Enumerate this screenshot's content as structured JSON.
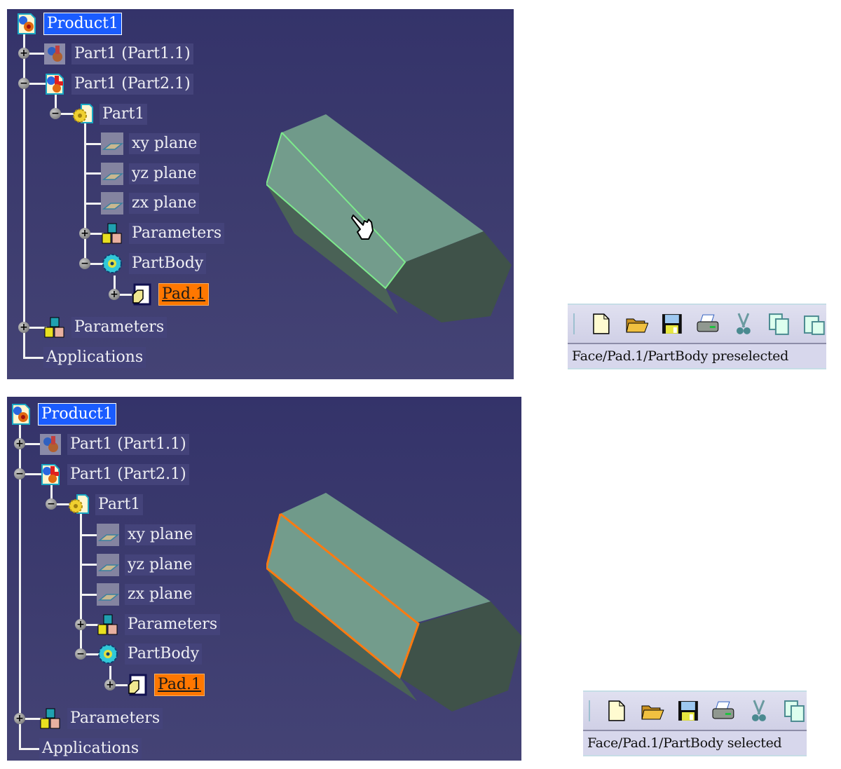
{
  "panels": [
    {
      "state": "preselected",
      "tree": {
        "root": "Product1",
        "items": [
          {
            "label": "Part1 (Part1.1)",
            "toggle": "+",
            "icon": "part-instance-icon"
          },
          {
            "label": "Part1 (Part2.1)",
            "toggle": "-",
            "icon": "part-instance-active-icon"
          },
          {
            "label": "Part1",
            "toggle": "-",
            "icon": "part-gear-icon"
          },
          {
            "label": "xy plane",
            "icon": "plane-icon"
          },
          {
            "label": "yz plane",
            "icon": "plane-icon"
          },
          {
            "label": "zx plane",
            "icon": "plane-icon"
          },
          {
            "label": "Parameters",
            "toggle": "+",
            "icon": "parameters-icon"
          },
          {
            "label": "PartBody",
            "toggle": "-",
            "icon": "partbody-icon"
          },
          {
            "label": "Pad.1",
            "toggle": "+",
            "icon": "pad-icon",
            "highlighted": true
          },
          {
            "label": "Parameters",
            "toggle": "+",
            "icon": "parameters-icon"
          },
          {
            "label": "Applications",
            "icon": null
          }
        ]
      },
      "edge_color": "#7dea8c",
      "cursor": "hand-pointer-icon",
      "toolbar": {
        "icons": [
          "new-file-icon",
          "open-folder-icon",
          "save-icon",
          "print-icon",
          "cut-icon",
          "copy-icon",
          "paste-icon"
        ],
        "status": "Face/Pad.1/PartBody preselected"
      }
    },
    {
      "state": "selected",
      "tree": {
        "root": "Product1",
        "items": [
          {
            "label": "Part1 (Part1.1)",
            "toggle": "+",
            "icon": "part-instance-icon"
          },
          {
            "label": "Part1 (Part2.1)",
            "toggle": "-",
            "icon": "part-instance-active-icon"
          },
          {
            "label": "Part1",
            "toggle": "-",
            "icon": "part-gear-icon"
          },
          {
            "label": "xy plane",
            "icon": "plane-icon"
          },
          {
            "label": "yz plane",
            "icon": "plane-icon"
          },
          {
            "label": "zx plane",
            "icon": "plane-icon"
          },
          {
            "label": "Parameters",
            "toggle": "+",
            "icon": "parameters-icon"
          },
          {
            "label": "PartBody",
            "toggle": "-",
            "icon": "partbody-icon"
          },
          {
            "label": "Pad.1",
            "toggle": "+",
            "icon": "pad-icon",
            "highlighted": true
          },
          {
            "label": "Parameters",
            "toggle": "+",
            "icon": "parameters-icon"
          },
          {
            "label": "Applications",
            "icon": null
          }
        ]
      },
      "edge_color": "#ff7a10",
      "cursor": null,
      "toolbar": {
        "icons": [
          "new-file-icon",
          "open-folder-icon",
          "save-icon",
          "print-icon",
          "cut-icon",
          "copy-icon"
        ],
        "status": "Face/Pad.1/PartBody selected"
      }
    }
  ],
  "colors": {
    "viewport_bg": "#3c3b6e",
    "face_light": "#70988a",
    "face_dark": "#3f5249",
    "selection": "#1a5cff",
    "highlight": "#ff7700"
  }
}
